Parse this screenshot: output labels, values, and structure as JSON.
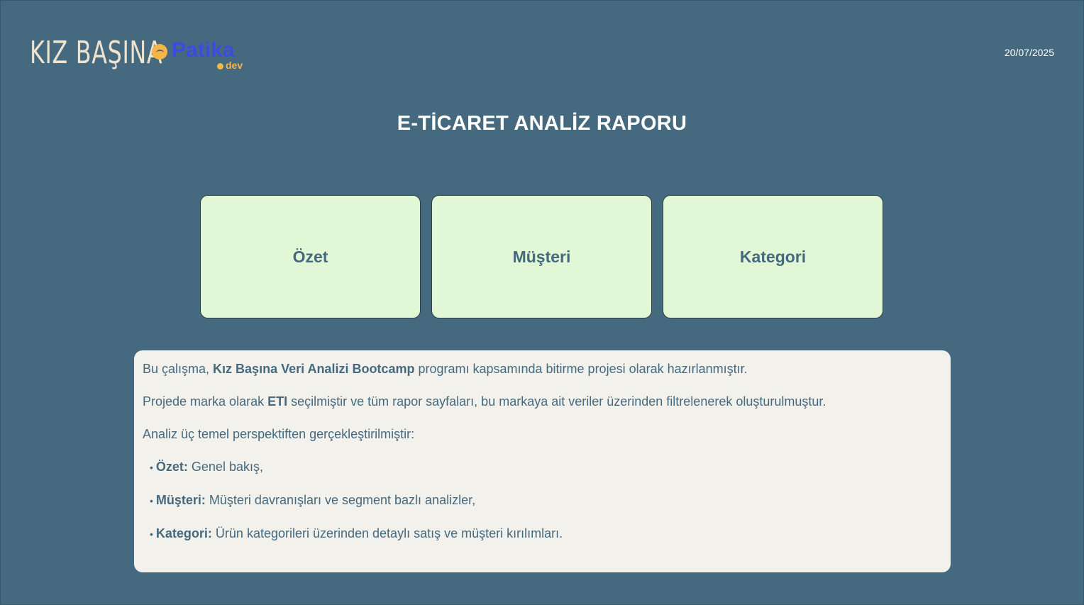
{
  "header": {
    "logo_kiz": "KIZ BAŞINA",
    "logo_patika_word": "Patika",
    "logo_patika_suffix": "dev",
    "date": "20/07/2025"
  },
  "title": "E-TİCARET ANALİZ RAPORU",
  "nav_tiles": [
    {
      "label": "Özet"
    },
    {
      "label": "Müşteri"
    },
    {
      "label": "Kategori"
    }
  ],
  "description": {
    "line1": {
      "pre": "Bu çalışma, ",
      "bold": "Kız Başına Veri Analizi Bootcamp",
      "post": " programı kapsamında bitirme projesi olarak hazırlanmıştır."
    },
    "line2": {
      "pre": "Projede marka olarak ",
      "bold": "ETI",
      "post": " seçilmiştir ve tüm rapor sayfaları, bu markaya ait veriler üzerinden filtrelenerek oluşturulmuştur."
    },
    "line3": "Analiz üç temel perspektiften gerçekleştirilmiştir:",
    "bullets": [
      {
        "bold": "Özet:",
        "text": " Genel bakış,"
      },
      {
        "bold": "Müşteri:",
        "text": " Müşteri davranışları ve segment bazlı analizler,"
      },
      {
        "bold": "Kategori:",
        "text": " Ürün kategorileri üzerinden detaylı satış ve müşteri kırılımları."
      }
    ]
  },
  "colors": {
    "background": "#45697F",
    "tile": "#E2F7D6",
    "panel": "#F2F1EB",
    "text": "#45697F",
    "patika_blue": "#3E4BE0",
    "patika_orange": "#F5B547"
  }
}
